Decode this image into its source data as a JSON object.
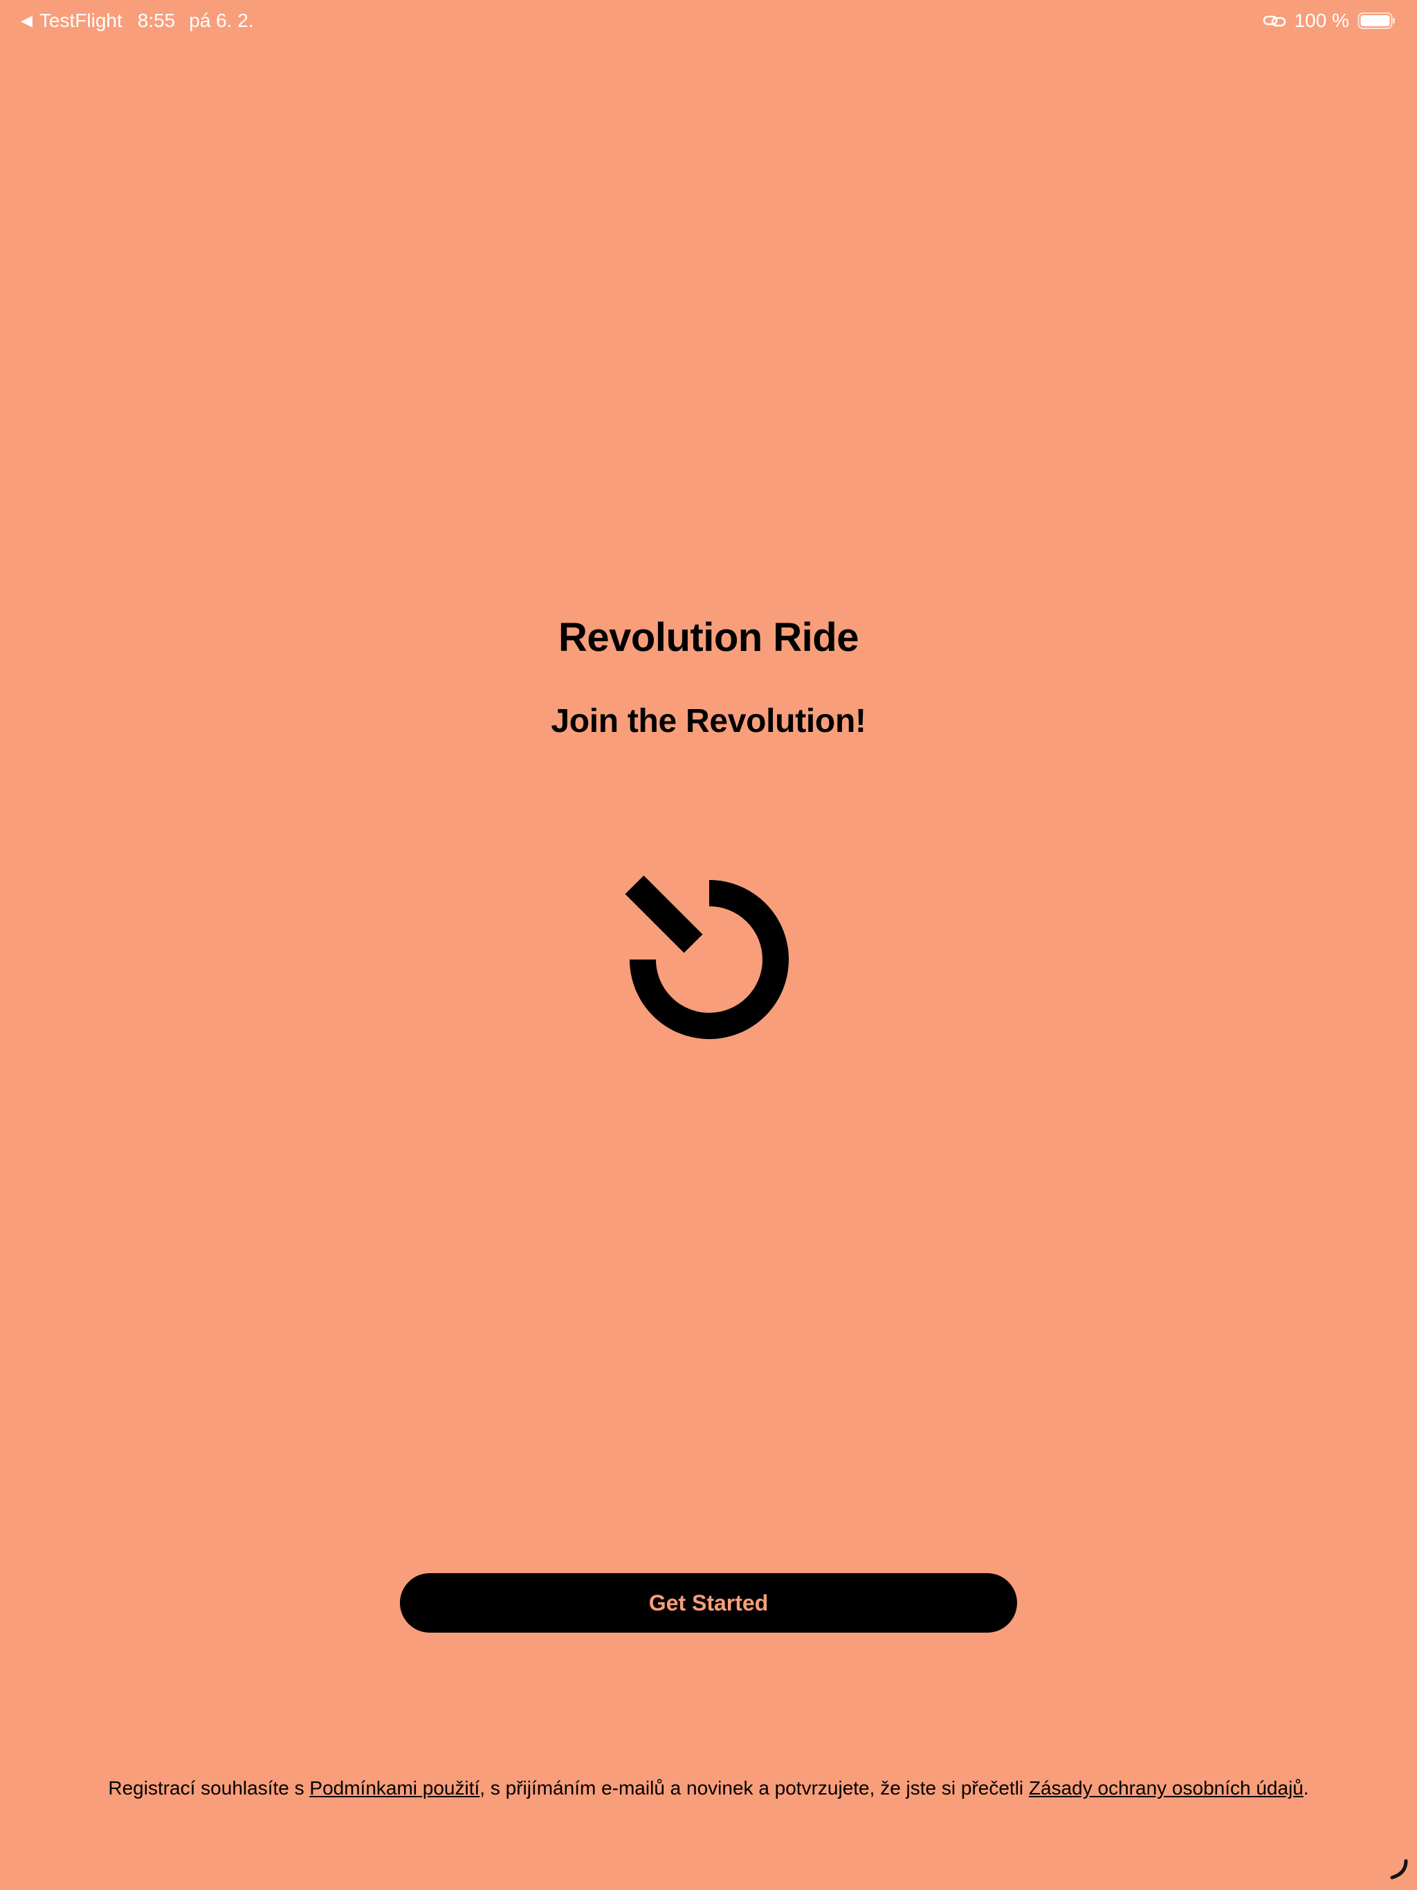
{
  "status_bar": {
    "back_app": "TestFlight",
    "time": "8:55",
    "date": "pá 6. 2.",
    "battery_percent": "100 %",
    "icons": [
      "back-arrow-icon",
      "link-icon",
      "battery-icon"
    ]
  },
  "main": {
    "title": "Revolution Ride",
    "tagline": "Join the Revolution!",
    "logo_icon": "revolution-power-logo-icon"
  },
  "actions": {
    "get_started_label": "Get Started"
  },
  "legal": {
    "text_before": "Registrací souhlasíte s ",
    "terms_link": "Podmínkami použití",
    "text_middle": ", s přijímáním e-mailů a novinek a potvrzujete, že jste si přečetli ",
    "privacy_link": "Zásady ochrany osobních údajů",
    "text_after": "."
  },
  "colors": {
    "background": "#F89E7B",
    "button_background": "#000000",
    "button_text": "#F89E7B",
    "text": "#000000",
    "status_text": "#FFFFFF"
  }
}
